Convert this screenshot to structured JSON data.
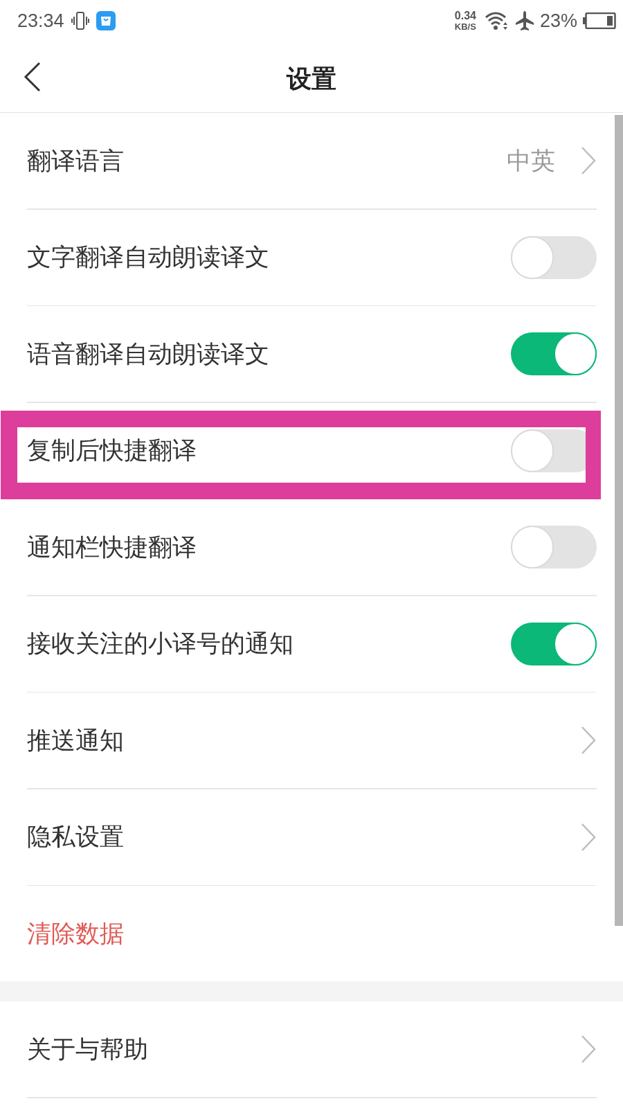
{
  "status_bar": {
    "time": "23:34",
    "net_speed": "0.34",
    "net_speed_unit": "KB/S",
    "battery": "23%"
  },
  "header": {
    "title": "设置"
  },
  "sections": [
    {
      "items": [
        {
          "kind": "link",
          "label": "翻译语言",
          "value": "中英",
          "highlighted": false
        },
        {
          "kind": "toggle",
          "label": "文字翻译自动朗读译文",
          "on": false,
          "highlighted": false
        },
        {
          "kind": "toggle",
          "label": "语音翻译自动朗读译文",
          "on": true,
          "highlighted": false
        },
        {
          "kind": "toggle",
          "label": "复制后快捷翻译",
          "on": false,
          "highlighted": true
        },
        {
          "kind": "toggle",
          "label": "通知栏快捷翻译",
          "on": false,
          "highlighted": false
        },
        {
          "kind": "toggle",
          "label": "接收关注的小译号的通知",
          "on": true,
          "highlighted": false
        },
        {
          "kind": "link",
          "label": "推送通知",
          "highlighted": false
        },
        {
          "kind": "link",
          "label": "隐私设置",
          "highlighted": false
        },
        {
          "kind": "action",
          "label": "清除数据",
          "highlighted": false
        }
      ]
    },
    {
      "items": [
        {
          "kind": "link",
          "label": "关于与帮助",
          "highlighted": false
        }
      ]
    }
  ]
}
